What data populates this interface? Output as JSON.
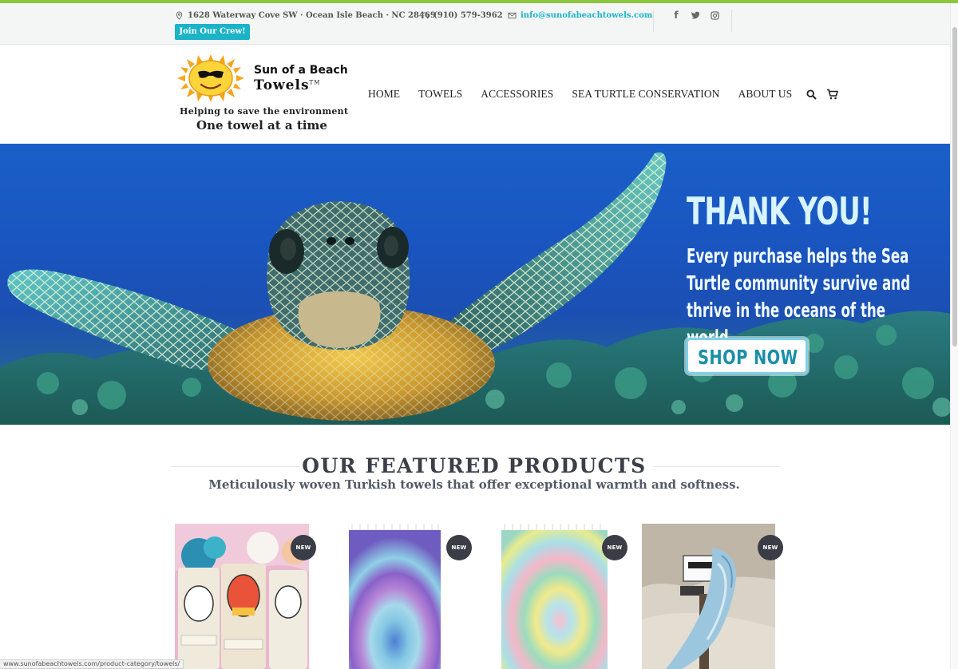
{
  "topbar": {
    "address": "1628 Waterway Cove SW · Ocean Isle Beach · NC 28469",
    "phone": "(910) 579-3962",
    "email": "info@sunofabeachtowels.com",
    "join_button": "Join Our Crew!",
    "accent_color": "#1bb3c7",
    "topline_color": "#8cc63f",
    "social_icons": [
      "facebook-icon",
      "twitter-icon",
      "instagram-icon"
    ]
  },
  "logo": {
    "brand_line1": "Sun of a Beach",
    "brand_line2": "Towels",
    "trademark": "TM",
    "tagline1": "Helping to save  the environment",
    "tagline2": "One towel at a time"
  },
  "nav": {
    "items": [
      {
        "label": "HOME"
      },
      {
        "label": "TOWELS"
      },
      {
        "label": "ACCESSORIES"
      },
      {
        "label": "SEA TURTLE CONSERVATION"
      },
      {
        "label": "ABOUT US"
      }
    ],
    "icons": [
      "search-icon",
      "cart-icon"
    ]
  },
  "hero": {
    "title": "THANK YOU!",
    "body": "Every purchase helps the Sea Turtle community survive and thrive in the oceans of the world.",
    "button": "SHOP NOW"
  },
  "featured": {
    "title": "OUR FEATURED PRODUCTS",
    "subtitle": "Meticulously woven Turkish towels that offer exceptional warmth and softness.",
    "products": [
      {
        "badge": "NEW"
      },
      {
        "badge": "NEW"
      },
      {
        "badge": "NEW"
      },
      {
        "badge": "NEW"
      }
    ]
  },
  "status": {
    "url": "www.sunofabeachtowels.com/product-category/towels/"
  }
}
